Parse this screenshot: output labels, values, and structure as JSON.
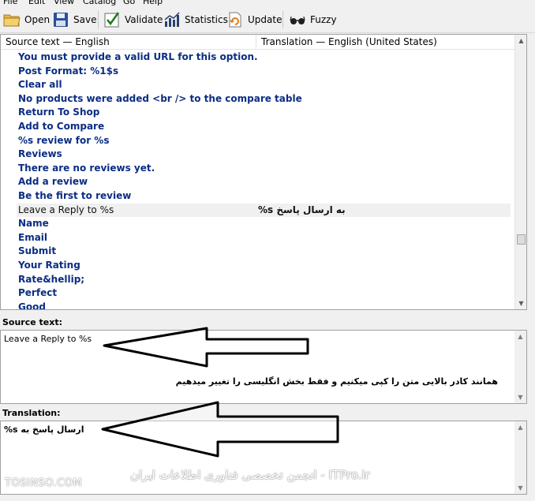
{
  "menu": [
    "File",
    "Edit",
    "View",
    "Catalog",
    "Go",
    "Help"
  ],
  "toolbar": {
    "open": "Open",
    "save": "Save",
    "validate": "Validate",
    "statistics": "Statistics",
    "update": "Update",
    "fuzzy": "Fuzzy"
  },
  "list": {
    "header_source": "Source text — English",
    "header_translation": "Translation — English (United States)",
    "rows": [
      {
        "src": "You must provide a valid URL for this option.",
        "trn": ""
      },
      {
        "src": "Post Format: %1$s",
        "trn": ""
      },
      {
        "src": "Clear all",
        "trn": ""
      },
      {
        "src": "No products were added <br /> to the compare table",
        "trn": ""
      },
      {
        "src": "Return To Shop",
        "trn": ""
      },
      {
        "src": "Add to Compare",
        "trn": ""
      },
      {
        "src": "%s review for %s",
        "trn": ""
      },
      {
        "src": "Reviews",
        "trn": ""
      },
      {
        "src": "There are no reviews yet.",
        "trn": ""
      },
      {
        "src": "Add a review",
        "trn": ""
      },
      {
        "src": "Be the first to review",
        "trn": ""
      },
      {
        "src": "Leave a Reply to %s",
        "trn": "%s به ارسال پاسخ"
      },
      {
        "src": "Name",
        "trn": ""
      },
      {
        "src": "Email",
        "trn": ""
      },
      {
        "src": "Submit",
        "trn": ""
      },
      {
        "src": "Your Rating",
        "trn": ""
      },
      {
        "src": "Rate&hellip;",
        "trn": ""
      },
      {
        "src": "Perfect",
        "trn": ""
      },
      {
        "src": "Good",
        "trn": ""
      }
    ],
    "selected_index": 11
  },
  "source_pane": {
    "label": "Source text:",
    "text": "Leave a Reply to %s",
    "note": "همانند کادر بالایی متن را کپی میکنیم و فقط بخش انگلیسی را تغییر میدهیم"
  },
  "translation_pane": {
    "label": "Translation:",
    "text": "%s ارسال پاسخ به"
  },
  "watermark": {
    "left": "TOSINSO.COM",
    "right": "ITPro.ir - انجمن تخصصی فناوری اطلاعات ایران"
  },
  "colors": {
    "untranslated_text": "#0b2d83",
    "selected_row_bg": "#f0f0f0"
  }
}
